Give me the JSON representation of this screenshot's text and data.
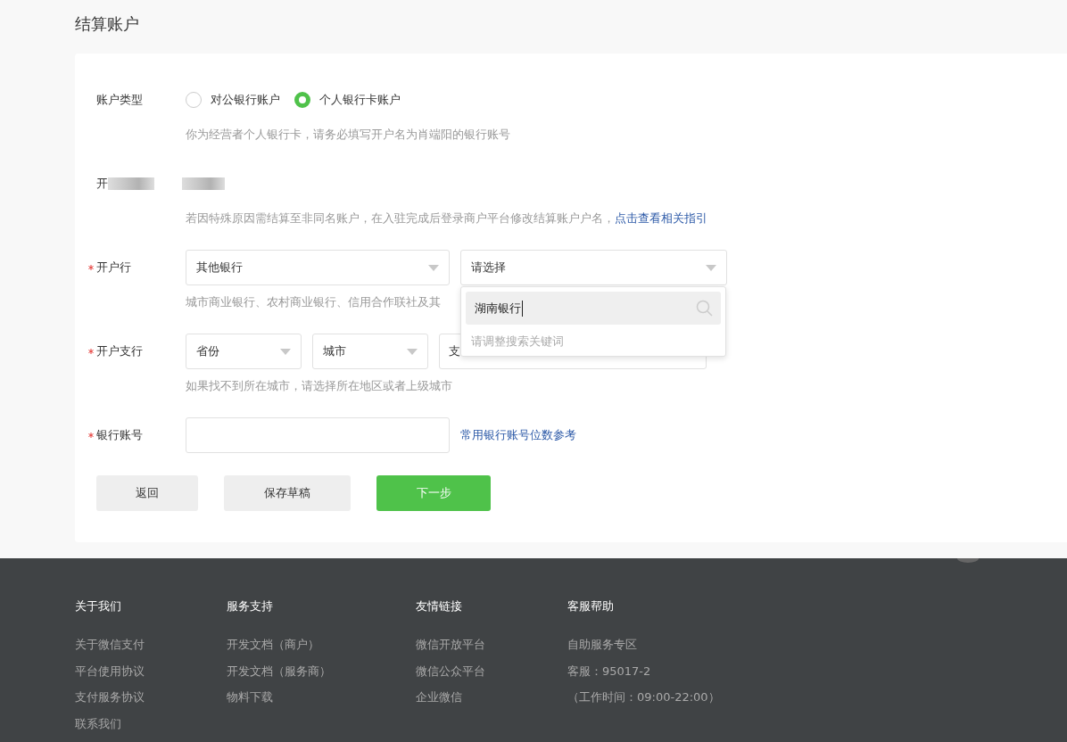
{
  "page_title": "结算账户",
  "account_type": {
    "label": "账户类型",
    "options": [
      {
        "label": "对公银行账户",
        "selected": false
      },
      {
        "label": "个人银行卡账户",
        "selected": true
      }
    ],
    "hint": "你为经营者个人银行卡，请务必填写开户名为肖端阳的银行账号"
  },
  "account_name": {
    "label": "开",
    "hint": "若因特殊原因需结算至非同名账户，在入驻完成后登录商户平台修改结算账户户名，",
    "hint_link": "点击查看相关指引"
  },
  "bank": {
    "label": "开户行",
    "required": true,
    "selects": [
      {
        "value": "其他银行"
      },
      {
        "value": "请选择"
      }
    ],
    "hint": "城市商业银行、农村商业银行、信用合作联社及其"
  },
  "bank_dropdown": {
    "search_value": "湖南银行",
    "empty_text": "请调整搜索关键词"
  },
  "branch": {
    "label": "开户支行",
    "required": true,
    "selects": [
      {
        "value": "省份"
      },
      {
        "value": "城市"
      }
    ],
    "search_placeholder": "支",
    "hint": "如果找不到所在城市，请选择所在地区或者上级城市"
  },
  "account_number": {
    "label": "银行账号",
    "required": true,
    "link": "常用银行账号位数参考"
  },
  "buttons": [
    {
      "label": "返回",
      "kind": "secondary"
    },
    {
      "label": "保存草稿",
      "kind": "secondary"
    },
    {
      "label": "下一步",
      "kind": "primary"
    }
  ],
  "footer": [
    {
      "heading": "关于我们",
      "links": [
        "关于微信支付",
        "平台使用协议",
        "支付服务协议",
        "联系我们"
      ]
    },
    {
      "heading": "服务支持",
      "links": [
        "开发文档（商户）",
        "开发文档（服务商）",
        "物料下载"
      ]
    },
    {
      "heading": "友情链接",
      "links": [
        "微信开放平台",
        "微信公众平台",
        "企业微信"
      ]
    },
    {
      "heading": "客服帮助",
      "links": [
        "自助服务专区",
        "客服：95017-2",
        "（工作时间：09:00-22:00）"
      ]
    }
  ]
}
